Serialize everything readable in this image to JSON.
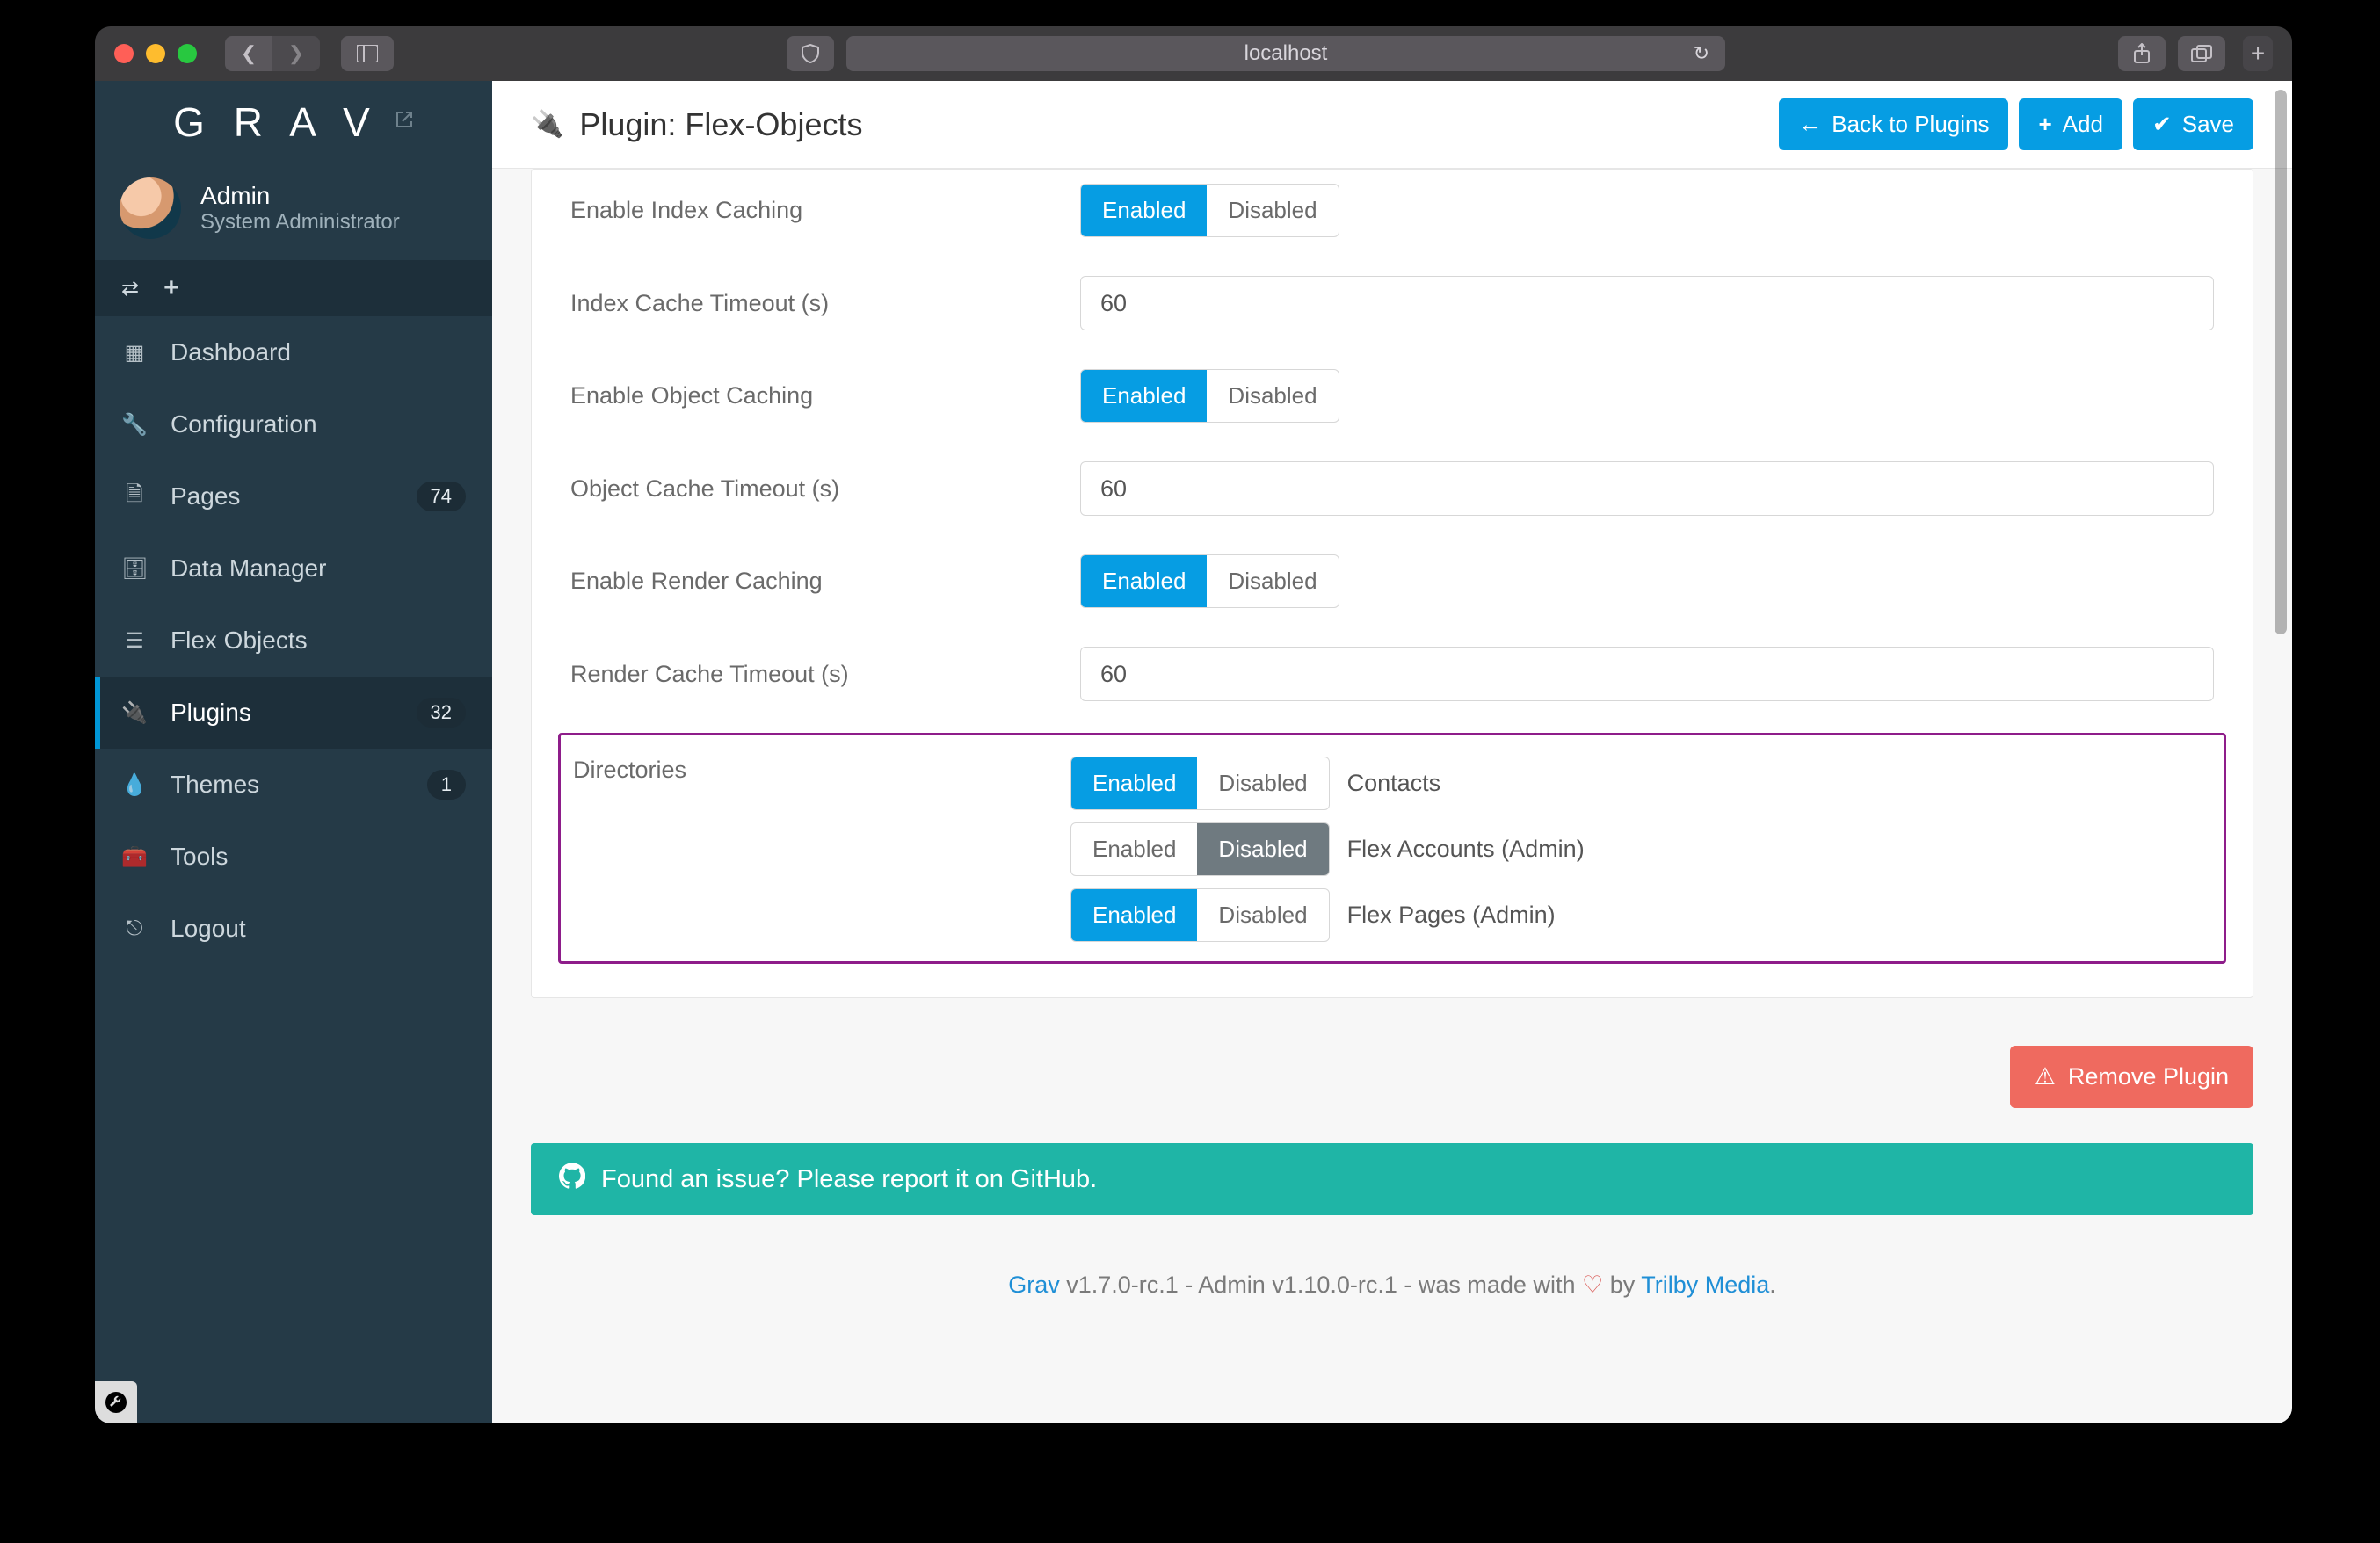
{
  "browser": {
    "url": "localhost"
  },
  "brand": "G R A V",
  "user": {
    "name": "Admin",
    "role": "System Administrator"
  },
  "nav": {
    "dashboard": "Dashboard",
    "configuration": "Configuration",
    "pages": "Pages",
    "pages_badge": "74",
    "data_manager": "Data Manager",
    "flex_objects": "Flex Objects",
    "plugins": "Plugins",
    "plugins_badge": "32",
    "themes": "Themes",
    "themes_badge": "1",
    "tools": "Tools",
    "logout": "Logout"
  },
  "header": {
    "title": "Plugin: Flex-Objects",
    "back": "Back to Plugins",
    "add": "Add",
    "save": "Save"
  },
  "toggle_labels": {
    "on": "Enabled",
    "off": "Disabled"
  },
  "form": {
    "enable_index_caching": "Enable Index Caching",
    "index_cache_timeout": "Index Cache Timeout (s)",
    "index_cache_timeout_value": "60",
    "enable_object_caching": "Enable Object Caching",
    "object_cache_timeout": "Object Cache Timeout (s)",
    "object_cache_timeout_value": "60",
    "enable_render_caching": "Enable Render Caching",
    "render_cache_timeout": "Render Cache Timeout (s)",
    "render_cache_timeout_value": "60",
    "directories_label": "Directories",
    "directories": {
      "contacts": "Contacts",
      "accounts": "Flex Accounts (Admin)",
      "pages": "Flex Pages (Admin)"
    }
  },
  "actions": {
    "remove_plugin": "Remove Plugin"
  },
  "issue_bar": "Found an issue? Please report it on GitHub.",
  "footer": {
    "grav": "Grav",
    "versions": " v1.7.0-rc.1 - Admin v1.10.0-rc.1 - was made with ",
    "by": " by ",
    "trilby": "Trilby Media",
    "period": "."
  }
}
